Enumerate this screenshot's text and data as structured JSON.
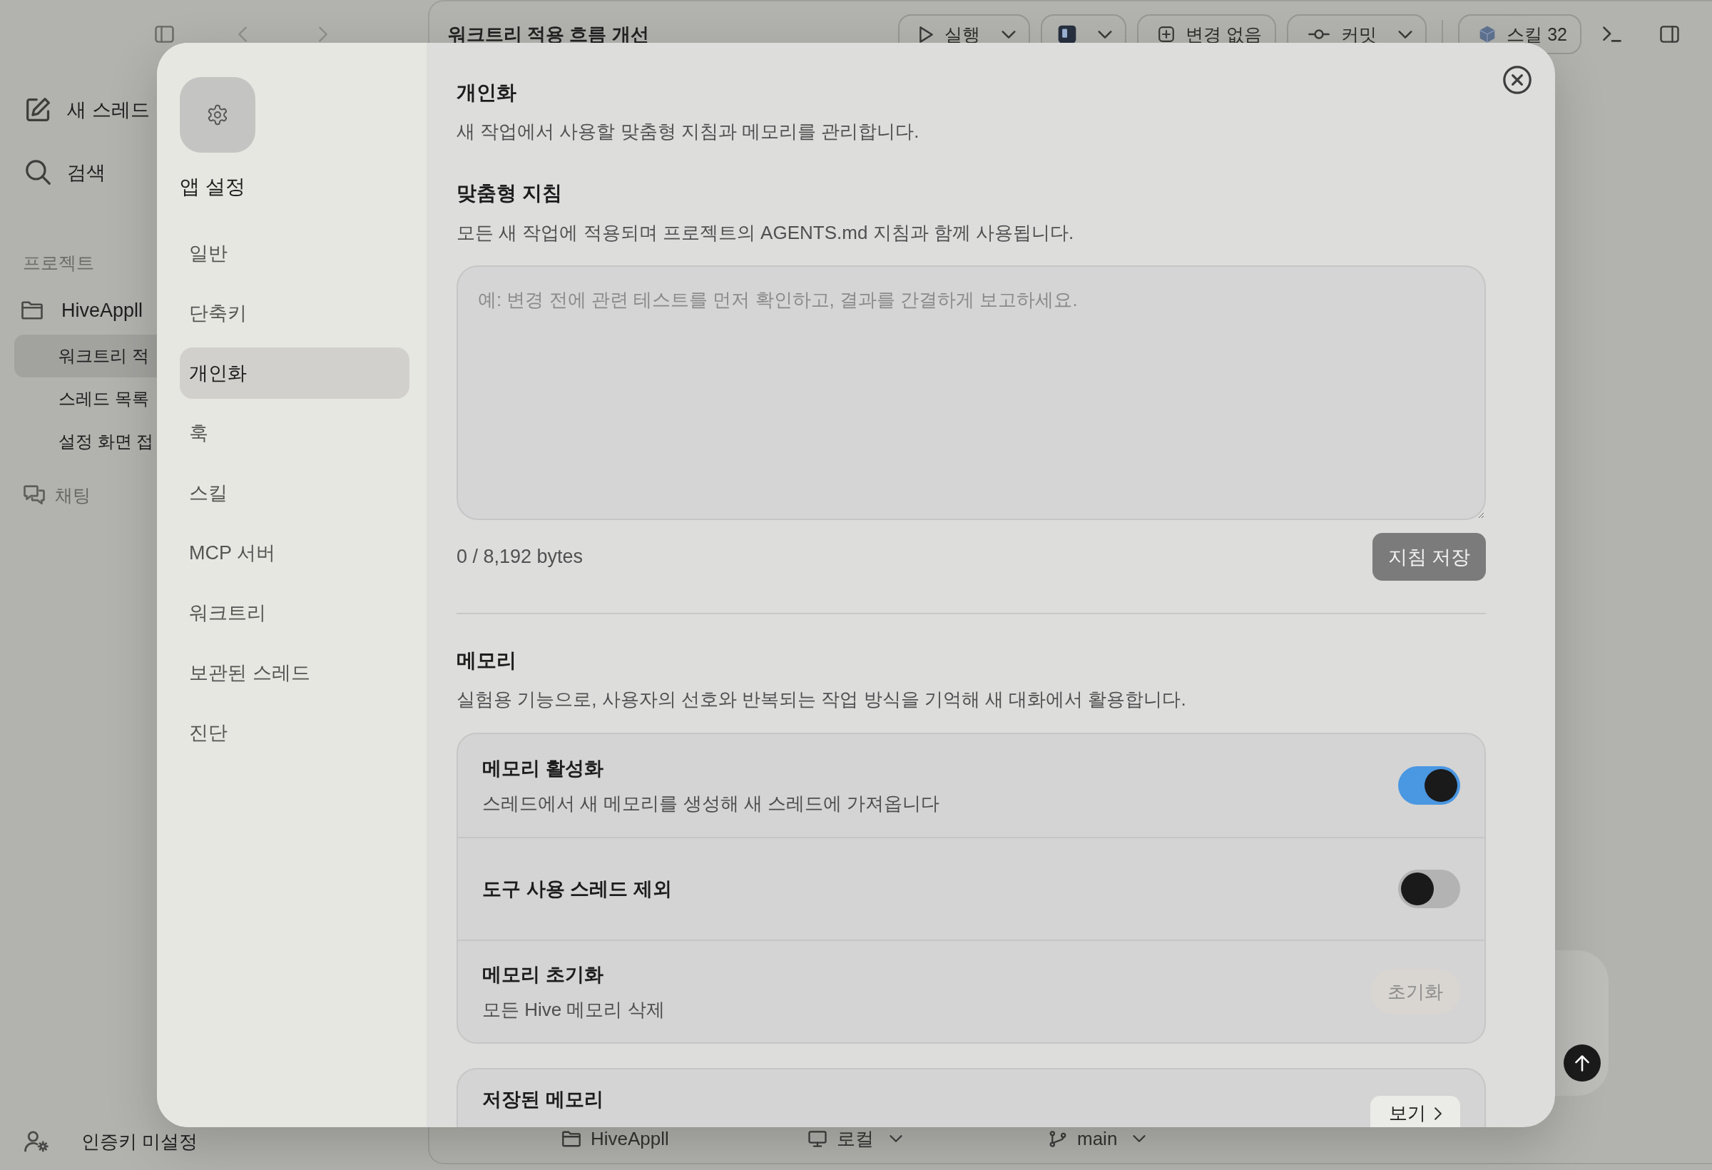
{
  "sidebar": {
    "actions": [
      {
        "label": "새 스레드"
      },
      {
        "label": "검색"
      }
    ],
    "section_label": "프로젝트",
    "project": {
      "label": "HiveAppll",
      "threads": [
        {
          "label": "워크트리 적",
          "selected": true
        },
        {
          "label": "스레드 목록",
          "selected": false
        },
        {
          "label": "설정 화면 접",
          "selected": false
        }
      ]
    },
    "chat": {
      "label": "채팅"
    },
    "account": {
      "label": "인증키 미설정"
    }
  },
  "toolbar": {
    "title": "워크트리 적용 흐름 개선",
    "buttons": [
      {
        "kind": "run",
        "label": "실행",
        "dropdown": true
      },
      {
        "kind": "app",
        "dropdown": true
      },
      {
        "kind": "changes",
        "label": "변경 없음",
        "dropdown": false
      },
      {
        "kind": "commit",
        "label": "커밋",
        "dropdown": true
      },
      {
        "kind": "skills",
        "label": "스킬 32",
        "dropdown": false
      }
    ]
  },
  "composer": {
    "footer": [
      {
        "kind": "project",
        "label": "HiveAppll",
        "dropdown": false
      },
      {
        "kind": "environment",
        "label": "로컬",
        "dropdown": true
      },
      {
        "kind": "branch",
        "label": "main",
        "dropdown": true
      }
    ]
  },
  "settings_dialog": {
    "nav": {
      "title": "앱 설정",
      "items": [
        {
          "label": "일반",
          "selected": false
        },
        {
          "label": "단축키",
          "selected": false
        },
        {
          "label": "개인화",
          "selected": true
        },
        {
          "label": "훅",
          "selected": false
        },
        {
          "label": "스킬",
          "selected": false
        },
        {
          "label": "MCP 서버",
          "selected": false
        },
        {
          "label": "워크트리",
          "selected": false
        },
        {
          "label": "보관된 스레드",
          "selected": false
        },
        {
          "label": "진단",
          "selected": false
        }
      ]
    },
    "page": {
      "title": "개인화",
      "description": "새 작업에서 사용할 맞춤형 지침과 메모리를 관리합니다."
    },
    "custom_instructions": {
      "title": "맞춤형 지침",
      "description": "모든 새 작업에 적용되며 프로젝트의 AGENTS.md 지침과 함께 사용됩니다.",
      "field": {
        "placeholder": "예: 변경 전에 관련 테스트를 먼저 확인하고, 결과를 간결하게 보고하세요."
      },
      "counter": "0 / 8,192 bytes",
      "save_button": {
        "label": "지침 저장"
      }
    },
    "memory": {
      "title": "메모리",
      "description": "실험용 기능으로, 사용자의 선호와 반복되는 작업 방식을 기억해 새 대화에서 활용합니다.",
      "settings": [
        {
          "kind": "toggle",
          "title": "메모리 활성화",
          "subtitle": "스레드에서 새 메모리를 생성해 새 스레드에 가져옵니다",
          "on": true
        },
        {
          "kind": "toggle",
          "title": "도구 사용 스레드 제외",
          "on": false
        },
        {
          "kind": "button",
          "title": "메모리 초기화",
          "subtitle": "모든 Hive 메모리 삭제",
          "button": {
            "label": "초기화",
            "disabled": true
          }
        }
      ]
    },
    "saved_memories": {
      "title": "저장된 메모리",
      "button": {
        "label": "보기"
      }
    }
  }
}
